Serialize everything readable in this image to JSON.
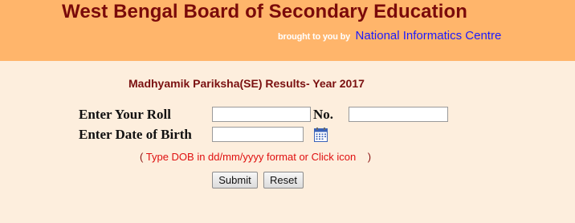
{
  "header": {
    "title": "West Bengal Board of Secondary Education",
    "credit_prefix": "brought to you by",
    "credit_org": "National Informatics Centre"
  },
  "main": {
    "heading": "Madhyamik Pariksha(SE) Results- Year 2017",
    "roll_label": "Enter Your Roll",
    "no_label": "No.",
    "roll_value": "",
    "no_value": "",
    "dob_label": "Enter Date of Birth",
    "dob_value": "",
    "hint_open": "(",
    "hint_text": "Type DOB in dd/mm/yyyy format or Click icon",
    "hint_close": ")",
    "submit_label": "Submit",
    "reset_label": "Reset"
  },
  "icons": {
    "calendar": "calendar-icon"
  },
  "colors": {
    "header_bg": "#ffb56b",
    "page_bg": "#fdeedd",
    "title": "#7a0a0a",
    "credit_org": "#1a1aff",
    "hint": "#e01010"
  }
}
